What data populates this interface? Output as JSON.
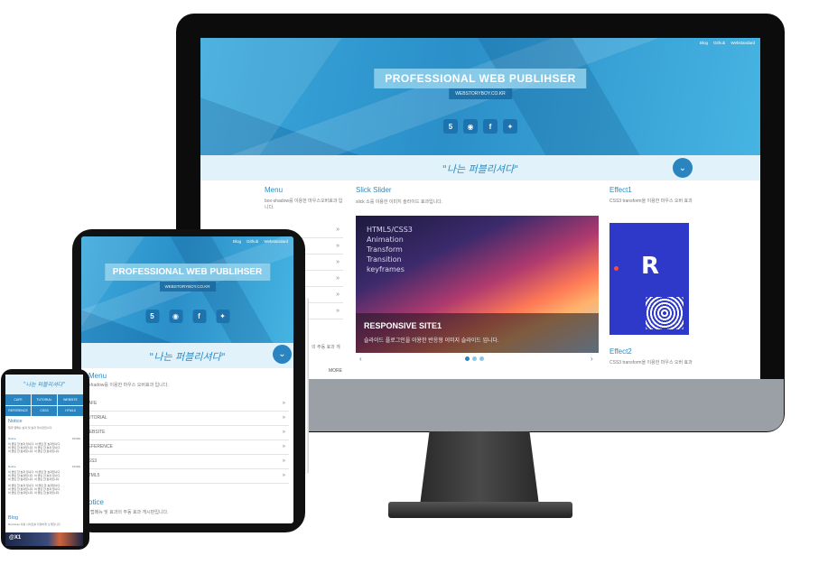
{
  "site": {
    "nav_links": [
      "Blog",
      "Github",
      "Webstandard"
    ],
    "title": "PROFESSIONAL WEB PUBLIHSER",
    "subtitle": "WEBSTORYBOY.CO.KR",
    "social_icons": [
      "html5-icon",
      "github-icon",
      "facebook-icon",
      "twitter-icon"
    ],
    "banner_slogan": "\"나는 퍼블리셔다\""
  },
  "monitor": {
    "menu": {
      "title": "Menu",
      "desc": "box-shadow를 이용한 마우스오버효과 입니다."
    },
    "slider": {
      "title": "Slick Slider",
      "desc": "slick 소를 이용한 이미지 슬라이드 효과입니다.",
      "image_lines": [
        "HTML5/CSS3",
        "Animation",
        "Transform",
        "Transition",
        "keyframes"
      ],
      "caption_title": "RESPONSIVE SITE1",
      "caption_text": "슬라이드 플로그인을 이용한 반응형 이미지 슬라이드 입니다."
    },
    "effect1": {
      "title": "Effect1",
      "desc": "CSS3 transform을 이용한 마우스 오버 효과"
    },
    "effect2": {
      "title": "Effect2",
      "desc": "CSS3 transform을 이용한 마우스 오버 효과"
    },
    "side_text": "의 주동 효과 게",
    "more": "MORE"
  },
  "tablet": {
    "menu_title": "Menu",
    "menu_desc": "x-shadow를 이용한 마우스 오버효과 입니다.",
    "menu_items": [
      "CAFE",
      "TUTORIAL",
      "WEBSITE",
      "REFERENCE",
      "CSS3",
      "HTML5"
    ],
    "notice_title": "otice",
    "notice_desc": "리 탭메뉴 및 효과의 주동 효과 게시판입니다."
  },
  "phone": {
    "banner": "\"나는 퍼블리셔다\"",
    "grid": [
      "CAFE",
      "TUTORIAL",
      "WEBSITE",
      "REFERENCE",
      "CSS3",
      "HTML5"
    ],
    "notice_title": "Notice",
    "notice_desc": "탭과 탭메뉴 효과 및 효과 게시판입니다.",
    "sublabels": [
      "Notice",
      "Notice"
    ],
    "more": "MORE",
    "notice_lines": [
      "이 클린 한 효과 입니다. 이 클린 한 효과입니다.",
      "이 클린 한 효과입니다. 이 클린 한 효과 입니다.",
      "이 클린 한 효과입니다. 이 클린 한 효과입니다."
    ],
    "blog_title": "Blog",
    "blog_desc": "Bootstrap 이용 사이트를 다양하게 소개합니다.",
    "footer_label": "@X1"
  },
  "colors": {
    "accent": "#2a8cc5",
    "hero": "#3aa9dc",
    "banner": "#e2f2fa"
  }
}
